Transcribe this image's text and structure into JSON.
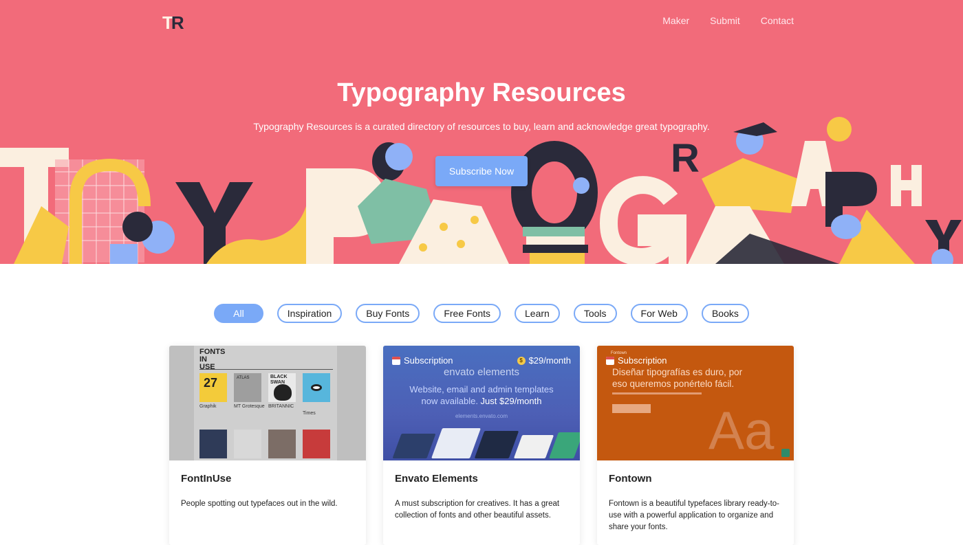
{
  "header": {
    "logo_t": "T",
    "logo_r": "R",
    "nav": [
      "Maker",
      "Submit",
      "Contact"
    ]
  },
  "hero": {
    "title": "Typography Resources",
    "subtitle": "Typography Resources is a curated directory of resources to buy, learn and acknowledge great typography.",
    "cta_label": "Subscribe Now",
    "colors": {
      "background": "#f26b7a",
      "accent": "#7aa9f7",
      "yellow": "#f7c946",
      "cream": "#fbefe0",
      "dark": "#2a2a3a"
    }
  },
  "filters": {
    "items": [
      "All",
      "Inspiration",
      "Buy Fonts",
      "Free Fonts",
      "Learn",
      "Tools",
      "For Web",
      "Books"
    ],
    "active": "All"
  },
  "cards": [
    {
      "title": "FontInUse",
      "description": "People spotting out typefaces out in the wild.",
      "thumb": {
        "brand": "FONTS IN USE",
        "tiles": [
          {
            "text": "27",
            "caption": "Graphik"
          },
          {
            "text": "ATLAS",
            "caption": "MT Grotesque"
          },
          {
            "text": "BLACK SWAN",
            "caption": "BRITANNIC"
          },
          {
            "text": "",
            "caption": "Times"
          }
        ]
      }
    },
    {
      "title": "Envato Elements",
      "description": "A must subscription for creatives. It has a great collection of fonts and other beautiful assets.",
      "thumb": {
        "badge": "Subscription",
        "price": "$29/month",
        "brand": "envato elements",
        "copy_line1": "Website, email and admin templates",
        "copy_line2a": "now available. ",
        "copy_line2b": "Just $29/month",
        "url": "elements.envato.com"
      }
    },
    {
      "title": "Fontown",
      "description": "Fontown is a beautiful typefaces library ready-to-use with a powerful application to organize and share your fonts.",
      "thumb": {
        "badge": "Subscription",
        "brand": "Fontown",
        "headline_line1": "Diseñar tipografías es duro, por",
        "headline_line2": "eso queremos ponértelo fácil.",
        "sample": "Aa"
      }
    }
  ]
}
